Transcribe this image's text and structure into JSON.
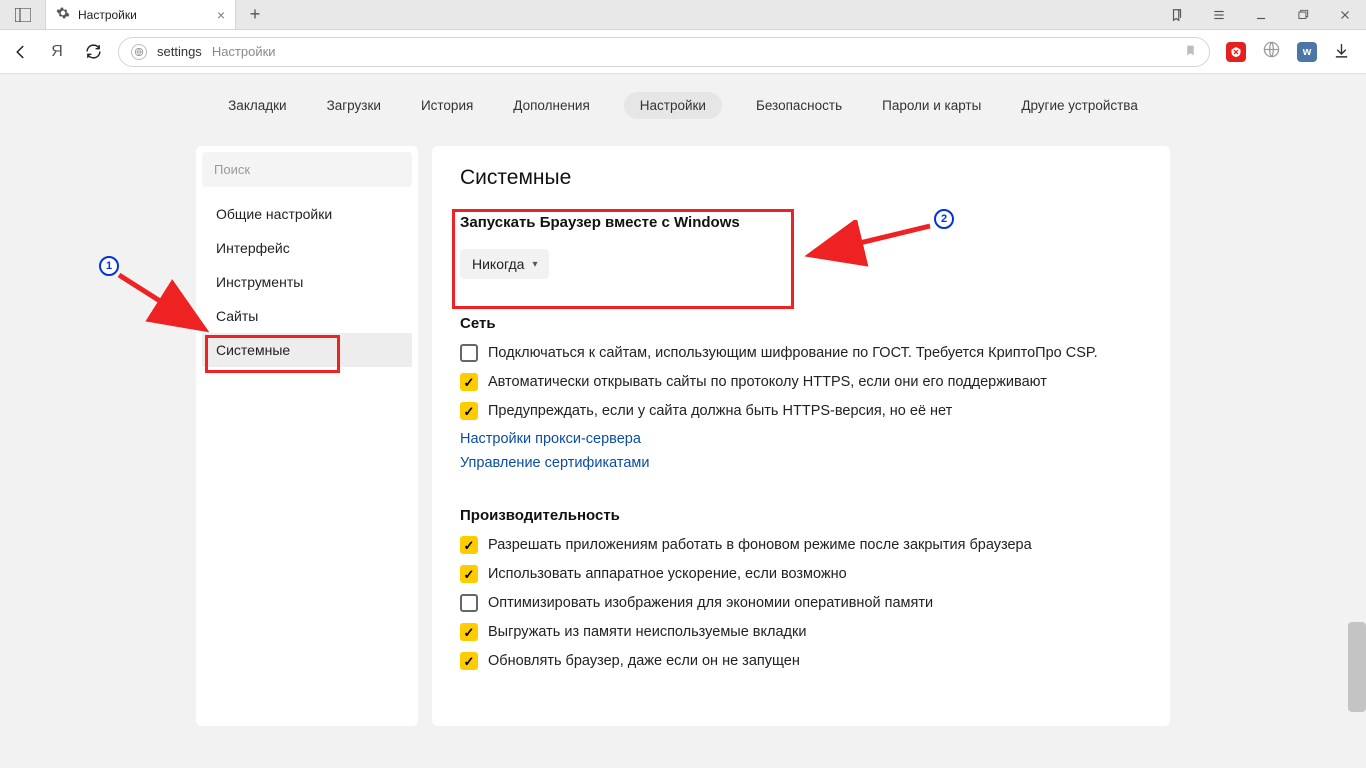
{
  "browser_tab": {
    "title": "Настройки"
  },
  "omnibox": {
    "segment1": "settings",
    "segment2": "Настройки"
  },
  "nav": {
    "items": [
      {
        "label": "Закладки"
      },
      {
        "label": "Загрузки"
      },
      {
        "label": "История"
      },
      {
        "label": "Дополнения"
      },
      {
        "label": "Настройки",
        "active": true
      },
      {
        "label": "Безопасность"
      },
      {
        "label": "Пароли и карты"
      },
      {
        "label": "Другие устройства"
      }
    ]
  },
  "sidebar": {
    "search_placeholder": "Поиск",
    "items": [
      {
        "label": "Общие настройки"
      },
      {
        "label": "Интерфейс"
      },
      {
        "label": "Инструменты"
      },
      {
        "label": "Сайты"
      },
      {
        "label": "Системные",
        "active": true
      }
    ]
  },
  "main": {
    "heading": "Системные",
    "startup": {
      "title": "Запускать Браузер вместе с Windows",
      "selected": "Никогда"
    },
    "network": {
      "title": "Сеть",
      "opts": [
        {
          "checked": false,
          "label": "Подключаться к сайтам, использующим шифрование по ГОСТ. Требуется КриптоПро CSP."
        },
        {
          "checked": true,
          "label": "Автоматически открывать сайты по протоколу HTTPS, если они его поддерживают"
        },
        {
          "checked": true,
          "label": "Предупреждать, если у сайта должна быть HTTPS-версия, но её нет"
        }
      ],
      "links": [
        "Настройки прокси-сервера",
        "Управление сертификатами"
      ]
    },
    "performance": {
      "title": "Производительность",
      "opts": [
        {
          "checked": true,
          "label": "Разрешать приложениям работать в фоновом режиме после закрытия браузера"
        },
        {
          "checked": true,
          "label": "Использовать аппаратное ускорение, если возможно"
        },
        {
          "checked": false,
          "label": "Оптимизировать изображения для экономии оперативной памяти"
        },
        {
          "checked": true,
          "label": "Выгружать из памяти неиспользуемые вкладки"
        },
        {
          "checked": true,
          "label": "Обновлять браузер, даже если он не запущен"
        }
      ]
    }
  },
  "annotations": {
    "badge1": "1",
    "badge2": "2"
  },
  "colors": {
    "accent": "#ffcc00",
    "link": "#0a4ea2",
    "red": "#e22"
  }
}
